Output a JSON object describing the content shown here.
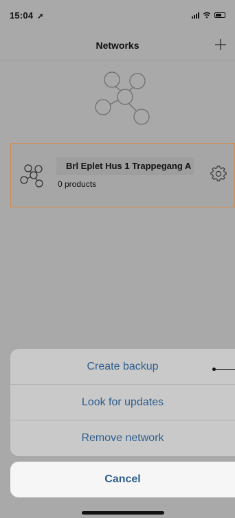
{
  "status_bar": {
    "time": "15:04",
    "location_icon": "location-arrow-icon"
  },
  "nav": {
    "title": "Networks",
    "add_icon": "plus-icon"
  },
  "network": {
    "name": "Brl Eplet Hus 1 Trappegang A",
    "products": "0 products"
  },
  "action_sheet": {
    "items": [
      {
        "label": "Create backup"
      },
      {
        "label": "Look for updates"
      },
      {
        "label": "Remove network"
      }
    ],
    "cancel_label": "Cancel"
  },
  "colors": {
    "background": "#a9a9a9",
    "accent": "#2e5f8f",
    "selected_border": "#d68a49",
    "sheet": "#c9c9c9",
    "cancel_bg": "#f6f6f6"
  }
}
